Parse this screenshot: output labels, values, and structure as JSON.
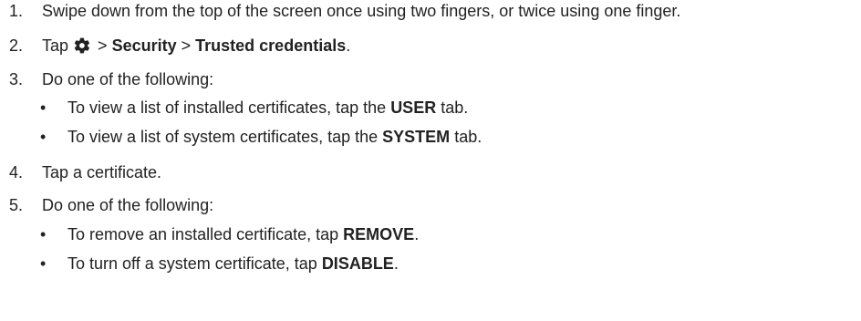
{
  "steps": [
    {
      "number": "1.",
      "text": "Swipe down from the top of the screen once using two fingers, or twice using one finger."
    },
    {
      "number": "2.",
      "prefix": "Tap",
      "icon": "gear-icon",
      "sep1": ">",
      "link1": "Security",
      "sep2": ">",
      "link2": "Trusted credentials",
      "suffix": "."
    },
    {
      "number": "3.",
      "text": "Do one of the following:",
      "bullets": [
        {
          "pre": "To view a list of installed certificates, tap the",
          "bold": "USER",
          "post": "tab."
        },
        {
          "pre": "To view a list of system certificates, tap the",
          "bold": "SYSTEM",
          "post": "tab."
        }
      ]
    },
    {
      "number": "4.",
      "text": "Tap a certificate."
    },
    {
      "number": "5.",
      "text": "Do one of the following:",
      "bullets": [
        {
          "pre": "To remove an installed certificate, tap",
          "bold": "REMOVE",
          "post": "."
        },
        {
          "pre": "To turn off a system certificate, tap",
          "bold": "DISABLE",
          "post": "."
        }
      ]
    }
  ],
  "bullet_symbol": "•",
  "colors": {
    "text": "#222222",
    "background": "#ffffff"
  }
}
